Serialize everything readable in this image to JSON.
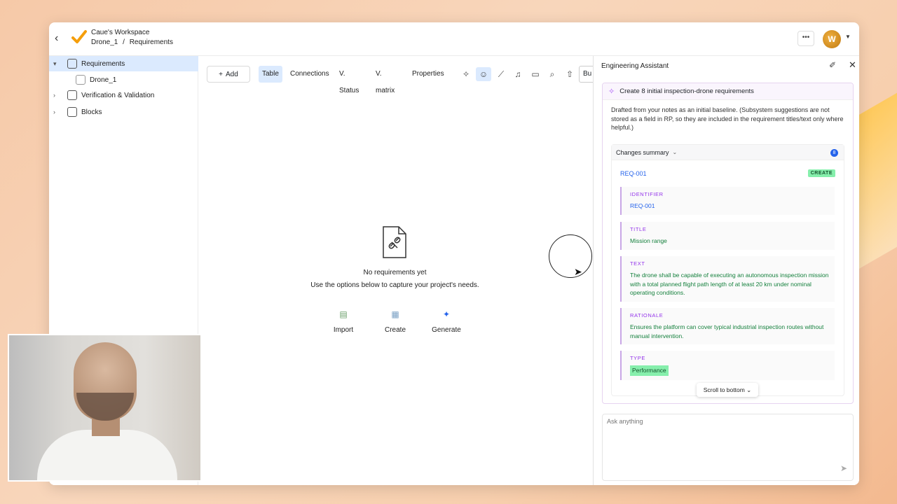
{
  "workspace": {
    "name": "Caue's Workspace",
    "breadcrumb": [
      "Drone_1",
      "/",
      "Requirements"
    ],
    "avatar_initial": "W"
  },
  "sidebar": {
    "items": [
      {
        "label": "Requirements",
        "icon": "requirements-icon",
        "expanded": true,
        "selected": true
      },
      {
        "label": "Drone_1",
        "icon": "document-icon",
        "child": true
      },
      {
        "label": "Verification & Validation",
        "icon": "verification-icon",
        "expanded": false
      },
      {
        "label": "Blocks",
        "icon": "blocks-icon",
        "expanded": false
      }
    ]
  },
  "toolbar": {
    "add_label": "Add",
    "tabs": [
      "Table",
      "Connections",
      "V. Status",
      "V. matrix",
      "Properties"
    ],
    "active_tab": "Table",
    "bu_label": "Bu"
  },
  "empty_state": {
    "title": "No requirements yet",
    "subtitle": "Use the options below to capture your project's needs.",
    "actions": [
      "Import",
      "Create",
      "Generate"
    ]
  },
  "assistant": {
    "title": "Engineering Assistant",
    "card_title": "Create 8 initial inspection-drone requirements",
    "card_description": "Drafted from your notes as an initial baseline. (Subsystem suggestions are not stored as a field in RP, so they are included in the requirement titles/text only where helpful.)",
    "summary_label": "Changes summary",
    "summary_count": "8",
    "req_id": "REQ-001",
    "create_tag": "CREATE",
    "fields": [
      {
        "label": "IDENTIFIER",
        "value": "REQ-001"
      },
      {
        "label": "TITLE",
        "value": "Mission range"
      },
      {
        "label": "TEXT",
        "value": "The drone shall be capable of executing an autonomous inspection mission with a total planned flight path length of at least 20 km under nominal operating conditions."
      },
      {
        "label": "RATIONALE",
        "value": "Ensures the platform can cover typical industrial inspection routes without manual intervention."
      },
      {
        "label": "TYPE",
        "value": "Performance"
      }
    ],
    "scroll_label": "Scroll to bottom",
    "ask_placeholder": "Ask anything"
  },
  "colors": {
    "accent": "#2563eb",
    "selected_bg": "#dbeafe",
    "create_green": "#86efac",
    "field_label_purple": "#9333ea",
    "logo_orange": "#f59e0b"
  }
}
